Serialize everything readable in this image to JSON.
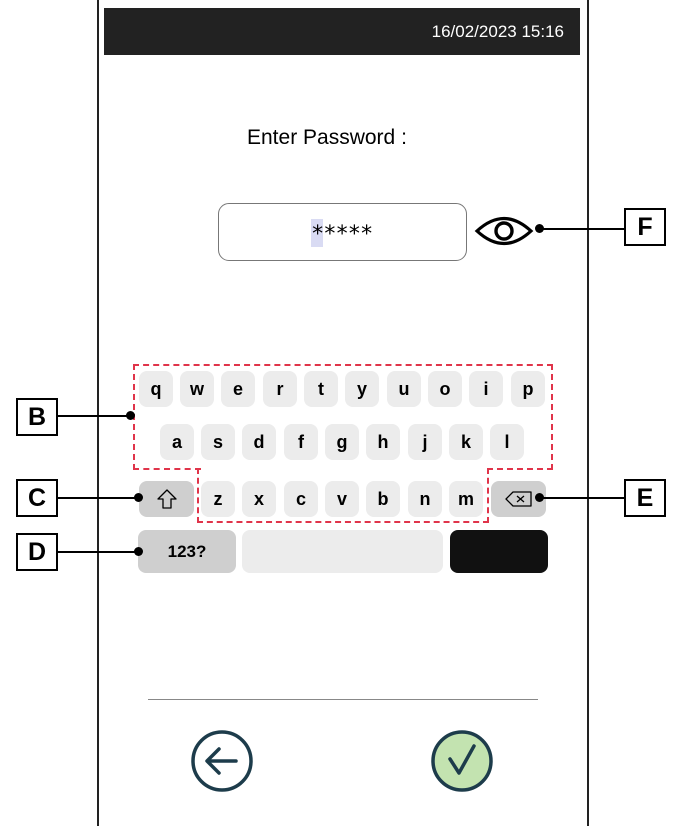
{
  "status_bar": {
    "datetime": "16/02/2023 15:16"
  },
  "prompt": "Enter Password :",
  "password_field": {
    "value": "*****"
  },
  "keyboard": {
    "row1": [
      "q",
      "w",
      "e",
      "r",
      "t",
      "y",
      "u",
      "o",
      "i",
      "p"
    ],
    "row2": [
      "a",
      "s",
      "d",
      "f",
      "g",
      "h",
      "j",
      "k",
      "l"
    ],
    "row3": [
      "z",
      "x",
      "c",
      "v",
      "b",
      "n",
      "m"
    ],
    "numbers_key": "123?"
  },
  "callouts": {
    "B": "B",
    "C": "C",
    "D": "D",
    "E": "E",
    "F": "F"
  },
  "colors": {
    "status_bar": "#222222",
    "annotation_dash": "#e0344a",
    "confirm_icon_fill": "#c3e3b0",
    "confirm_icon_stroke": "#1d3c4b"
  },
  "icons": {
    "shift": "shift-arrow-icon",
    "backspace": "backspace-icon",
    "eye": "eye-icon",
    "back": "arrow-left-circle-icon",
    "confirm": "checkmark-circle-icon"
  }
}
